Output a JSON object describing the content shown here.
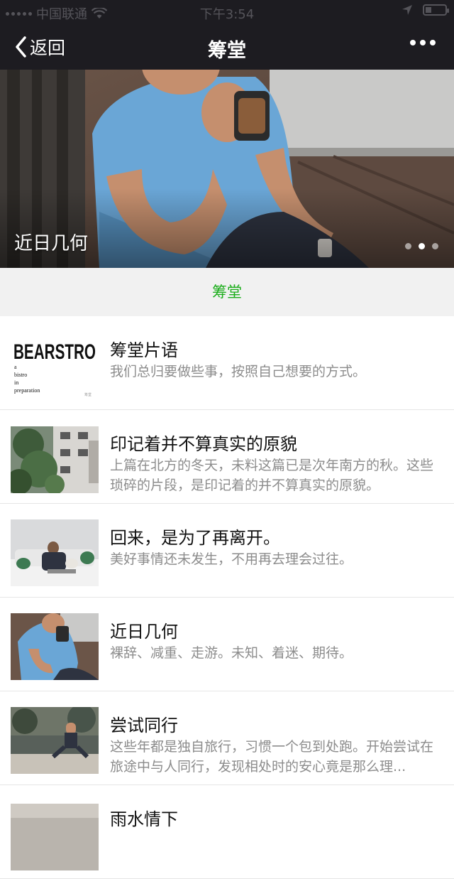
{
  "status_bar": {
    "carrier": "中国联通",
    "time": "下午3:54"
  },
  "nav": {
    "back_label": "返回",
    "title": "筹堂"
  },
  "banner": {
    "caption": "近日几何",
    "pages": 3,
    "active_page": 2
  },
  "section": {
    "title": "筹堂"
  },
  "articles": [
    {
      "title": "筹堂片语",
      "desc": "我们总归要做些事，按照自己想要的方式。",
      "thumb": {
        "brand": "BEARSTRO",
        "lines": [
          "a",
          "bistro",
          "in",
          "preparation"
        ],
        "mark": "筹堂"
      }
    },
    {
      "title": "印记着并不算真实的原貌",
      "desc": "上篇在北方的冬天，未料这篇已是次年南方的秋。这些琐碎的片段，是印记着的并不算真实的原貌。"
    },
    {
      "title": "回来，是为了再离开。",
      "desc": "美好事情还未发生，不用再去理会过往。"
    },
    {
      "title": "近日几何",
      "desc": "裸辞、减重、走游。未知、着迷、期待。"
    },
    {
      "title": "尝试同行",
      "desc": "这些年都是独自旅行，习惯一个包到处跑。开始尝试在旅途中与人同行，发现相处时的安心竟是那么理..."
    },
    {
      "title": "雨水情下",
      "desc": ""
    }
  ],
  "colors": {
    "nav_bg": "#1d1c21",
    "accent_green": "#1aad19",
    "desc_gray": "#8c8c8c"
  }
}
